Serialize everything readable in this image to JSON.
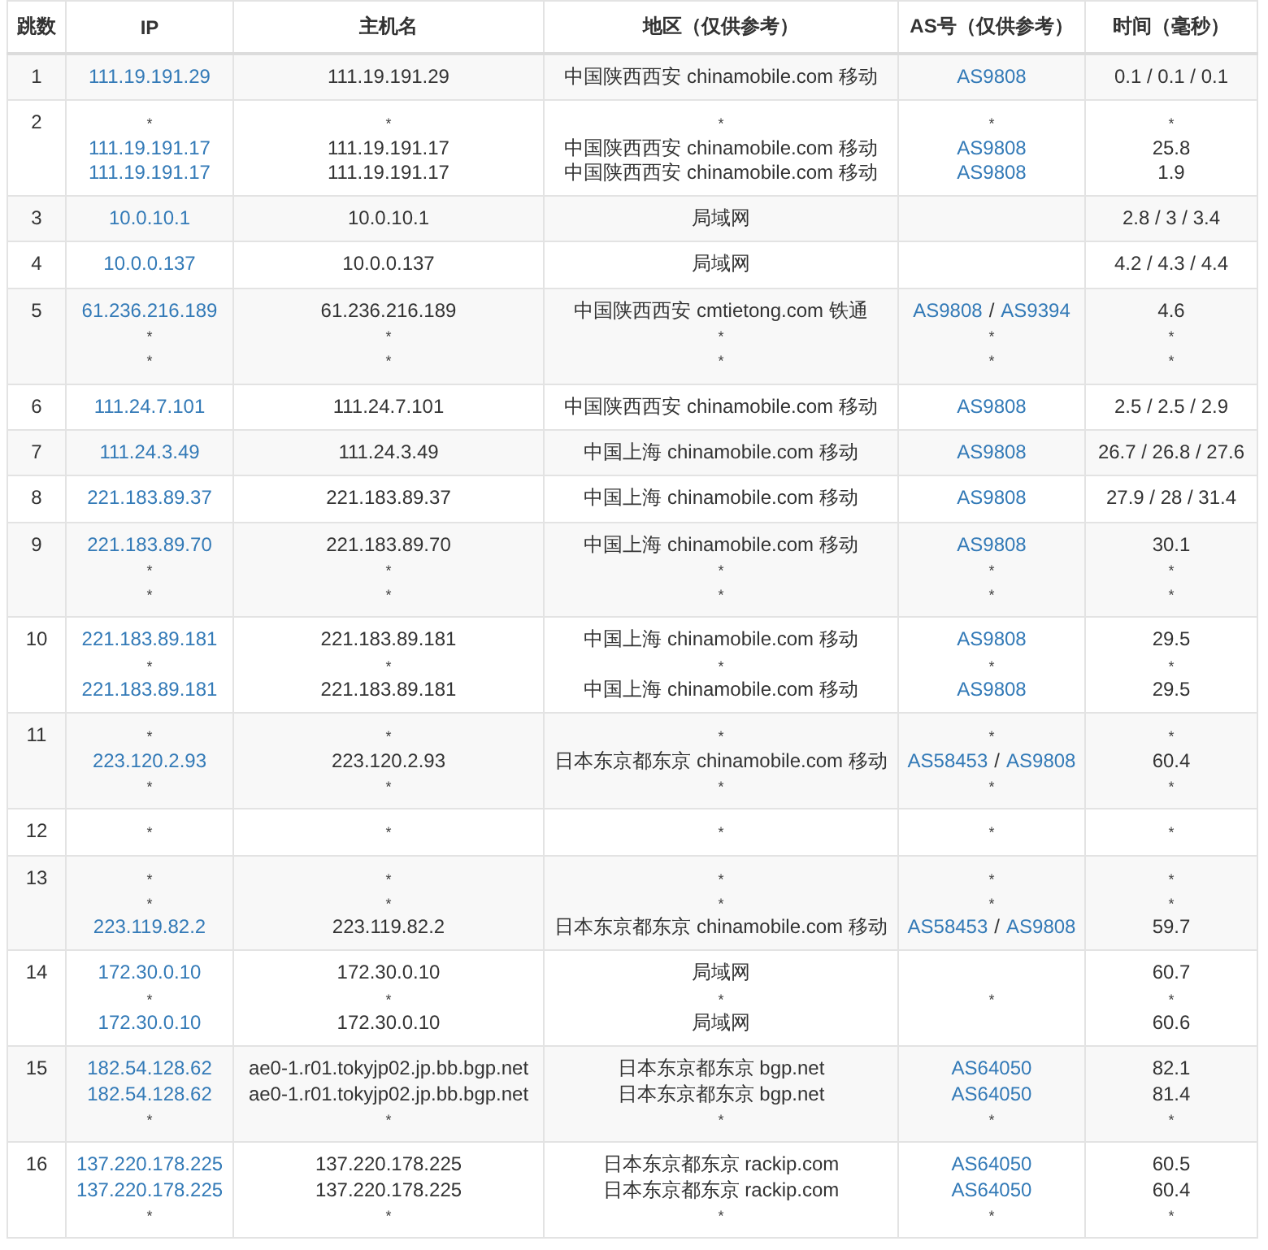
{
  "columns": [
    "跳数",
    "IP",
    "主机名",
    "地区（仅供参考）",
    "AS号（仅供参考）",
    "时间（毫秒）"
  ],
  "hops": [
    {
      "hop": "1",
      "ip": [
        {
          "kind": "link",
          "text": "111.19.191.29"
        }
      ],
      "host": [
        {
          "kind": "text",
          "text": "111.19.191.29"
        }
      ],
      "region": [
        {
          "kind": "text",
          "text": "中国陕西西安 chinamobile.com 移动"
        }
      ],
      "asn": [
        {
          "kind": "as",
          "parts": [
            "AS9808"
          ]
        }
      ],
      "time": [
        {
          "kind": "text",
          "text": "0.1 / 0.1 / 0.1"
        }
      ]
    },
    {
      "hop": "2",
      "ip": [
        {
          "kind": "star",
          "text": "*"
        },
        {
          "kind": "link",
          "text": "111.19.191.17"
        },
        {
          "kind": "link",
          "text": "111.19.191.17"
        }
      ],
      "host": [
        {
          "kind": "star",
          "text": "*"
        },
        {
          "kind": "text",
          "text": "111.19.191.17"
        },
        {
          "kind": "text",
          "text": "111.19.191.17"
        }
      ],
      "region": [
        {
          "kind": "star",
          "text": "*"
        },
        {
          "kind": "text",
          "text": "中国陕西西安 chinamobile.com 移动"
        },
        {
          "kind": "text",
          "text": "中国陕西西安 chinamobile.com 移动"
        }
      ],
      "asn": [
        {
          "kind": "star",
          "text": "*"
        },
        {
          "kind": "as",
          "parts": [
            "AS9808"
          ]
        },
        {
          "kind": "as",
          "parts": [
            "AS9808"
          ]
        }
      ],
      "time": [
        {
          "kind": "star",
          "text": "*"
        },
        {
          "kind": "text",
          "text": "25.8"
        },
        {
          "kind": "text",
          "text": "1.9"
        }
      ]
    },
    {
      "hop": "3",
      "ip": [
        {
          "kind": "link",
          "text": "10.0.10.1"
        }
      ],
      "host": [
        {
          "kind": "text",
          "text": "10.0.10.1"
        }
      ],
      "region": [
        {
          "kind": "text",
          "text": "局域网"
        }
      ],
      "time": [
        {
          "kind": "text",
          "text": "2.8 / 3 / 3.4"
        }
      ]
    },
    {
      "hop": "4",
      "ip": [
        {
          "kind": "link",
          "text": "10.0.0.137"
        }
      ],
      "host": [
        {
          "kind": "text",
          "text": "10.0.0.137"
        }
      ],
      "region": [
        {
          "kind": "text",
          "text": "局域网"
        }
      ],
      "time": [
        {
          "kind": "text",
          "text": "4.2 / 4.3 / 4.4"
        }
      ]
    },
    {
      "hop": "5",
      "ip": [
        {
          "kind": "link",
          "text": "61.236.216.189"
        },
        {
          "kind": "star",
          "text": "*"
        },
        {
          "kind": "star",
          "text": "*"
        }
      ],
      "host": [
        {
          "kind": "text",
          "text": "61.236.216.189"
        },
        {
          "kind": "star",
          "text": "*"
        },
        {
          "kind": "star",
          "text": "*"
        }
      ],
      "region": [
        {
          "kind": "text",
          "text": "中国陕西西安 cmtietong.com 铁通"
        },
        {
          "kind": "star",
          "text": "*"
        },
        {
          "kind": "star",
          "text": "*"
        }
      ],
      "asn": [
        {
          "kind": "as",
          "parts": [
            "AS9808",
            "/",
            "AS9394"
          ]
        },
        {
          "kind": "star",
          "text": "*"
        },
        {
          "kind": "star",
          "text": "*"
        }
      ],
      "time": [
        {
          "kind": "text",
          "text": "4.6"
        },
        {
          "kind": "star",
          "text": "*"
        },
        {
          "kind": "star",
          "text": "*"
        }
      ]
    },
    {
      "hop": "6",
      "ip": [
        {
          "kind": "link",
          "text": "111.24.7.101"
        }
      ],
      "host": [
        {
          "kind": "text",
          "text": "111.24.7.101"
        }
      ],
      "region": [
        {
          "kind": "text",
          "text": "中国陕西西安 chinamobile.com 移动"
        }
      ],
      "asn": [
        {
          "kind": "as",
          "parts": [
            "AS9808"
          ]
        }
      ],
      "time": [
        {
          "kind": "text",
          "text": "2.5 / 2.5 / 2.9"
        }
      ]
    },
    {
      "hop": "7",
      "ip": [
        {
          "kind": "link",
          "text": "111.24.3.49"
        }
      ],
      "host": [
        {
          "kind": "text",
          "text": "111.24.3.49"
        }
      ],
      "region": [
        {
          "kind": "text",
          "text": "中国上海 chinamobile.com 移动"
        }
      ],
      "asn": [
        {
          "kind": "as",
          "parts": [
            "AS9808"
          ]
        }
      ],
      "time": [
        {
          "kind": "text",
          "text": "26.7 / 26.8 / 27.6"
        }
      ]
    },
    {
      "hop": "8",
      "ip": [
        {
          "kind": "link",
          "text": "221.183.89.37"
        }
      ],
      "host": [
        {
          "kind": "text",
          "text": "221.183.89.37"
        }
      ],
      "region": [
        {
          "kind": "text",
          "text": "中国上海 chinamobile.com 移动"
        }
      ],
      "asn": [
        {
          "kind": "as",
          "parts": [
            "AS9808"
          ]
        }
      ],
      "time": [
        {
          "kind": "text",
          "text": "27.9 / 28 / 31.4"
        }
      ]
    },
    {
      "hop": "9",
      "ip": [
        {
          "kind": "link",
          "text": "221.183.89.70"
        },
        {
          "kind": "star",
          "text": "*"
        },
        {
          "kind": "star",
          "text": "*"
        }
      ],
      "host": [
        {
          "kind": "text",
          "text": "221.183.89.70"
        },
        {
          "kind": "star",
          "text": "*"
        },
        {
          "kind": "star",
          "text": "*"
        }
      ],
      "region": [
        {
          "kind": "text",
          "text": "中国上海 chinamobile.com 移动"
        },
        {
          "kind": "star",
          "text": "*"
        },
        {
          "kind": "star",
          "text": "*"
        }
      ],
      "asn": [
        {
          "kind": "as",
          "parts": [
            "AS9808"
          ]
        },
        {
          "kind": "star",
          "text": "*"
        },
        {
          "kind": "star",
          "text": "*"
        }
      ],
      "time": [
        {
          "kind": "text",
          "text": "30.1"
        },
        {
          "kind": "star",
          "text": "*"
        },
        {
          "kind": "star",
          "text": "*"
        }
      ]
    },
    {
      "hop": "10",
      "ip": [
        {
          "kind": "link",
          "text": "221.183.89.181"
        },
        {
          "kind": "star",
          "text": "*"
        },
        {
          "kind": "link",
          "text": "221.183.89.181"
        }
      ],
      "host": [
        {
          "kind": "text",
          "text": "221.183.89.181"
        },
        {
          "kind": "star",
          "text": "*"
        },
        {
          "kind": "text",
          "text": "221.183.89.181"
        }
      ],
      "region": [
        {
          "kind": "text",
          "text": "中国上海 chinamobile.com 移动"
        },
        {
          "kind": "star",
          "text": "*"
        },
        {
          "kind": "text",
          "text": "中国上海 chinamobile.com 移动"
        }
      ],
      "asn": [
        {
          "kind": "as",
          "parts": [
            "AS9808"
          ]
        },
        {
          "kind": "star",
          "text": "*"
        },
        {
          "kind": "as",
          "parts": [
            "AS9808"
          ]
        }
      ],
      "time": [
        {
          "kind": "text",
          "text": "29.5"
        },
        {
          "kind": "star",
          "text": "*"
        },
        {
          "kind": "text",
          "text": "29.5"
        }
      ]
    },
    {
      "hop": "11",
      "ip": [
        {
          "kind": "star",
          "text": "*"
        },
        {
          "kind": "link",
          "text": "223.120.2.93"
        },
        {
          "kind": "star",
          "text": "*"
        }
      ],
      "host": [
        {
          "kind": "star",
          "text": "*"
        },
        {
          "kind": "text",
          "text": "223.120.2.93"
        },
        {
          "kind": "star",
          "text": "*"
        }
      ],
      "region": [
        {
          "kind": "star",
          "text": "*"
        },
        {
          "kind": "text",
          "text": "日本东京都东京 chinamobile.com 移动"
        },
        {
          "kind": "star",
          "text": "*"
        }
      ],
      "asn": [
        {
          "kind": "star",
          "text": "*"
        },
        {
          "kind": "as",
          "parts": [
            "AS58453",
            "/",
            "AS9808"
          ]
        },
        {
          "kind": "star",
          "text": "*"
        }
      ],
      "time": [
        {
          "kind": "star",
          "text": "*"
        },
        {
          "kind": "text",
          "text": "60.4"
        },
        {
          "kind": "star",
          "text": "*"
        }
      ]
    },
    {
      "hop": "12",
      "ip": [
        {
          "kind": "star",
          "text": "*"
        }
      ],
      "host": [
        {
          "kind": "star",
          "text": "*"
        }
      ],
      "region": [
        {
          "kind": "star",
          "text": "*"
        }
      ],
      "asn": [
        {
          "kind": "star",
          "text": "*"
        }
      ],
      "time": [
        {
          "kind": "star",
          "text": "*"
        }
      ]
    },
    {
      "hop": "13",
      "ip": [
        {
          "kind": "star",
          "text": "*"
        },
        {
          "kind": "star",
          "text": "*"
        },
        {
          "kind": "link",
          "text": "223.119.82.2"
        }
      ],
      "host": [
        {
          "kind": "star",
          "text": "*"
        },
        {
          "kind": "star",
          "text": "*"
        },
        {
          "kind": "text",
          "text": "223.119.82.2"
        }
      ],
      "region": [
        {
          "kind": "star",
          "text": "*"
        },
        {
          "kind": "star",
          "text": "*"
        },
        {
          "kind": "text",
          "text": "日本东京都东京 chinamobile.com 移动"
        }
      ],
      "asn": [
        {
          "kind": "star",
          "text": "*"
        },
        {
          "kind": "star",
          "text": "*"
        },
        {
          "kind": "as",
          "parts": [
            "AS58453",
            "/",
            "AS9808"
          ]
        }
      ],
      "time": [
        {
          "kind": "star",
          "text": "*"
        },
        {
          "kind": "star",
          "text": "*"
        },
        {
          "kind": "text",
          "text": "59.7"
        }
      ]
    },
    {
      "hop": "14",
      "ip": [
        {
          "kind": "link",
          "text": "172.30.0.10"
        },
        {
          "kind": "star",
          "text": "*"
        },
        {
          "kind": "link",
          "text": "172.30.0.10"
        }
      ],
      "host": [
        {
          "kind": "text",
          "text": "172.30.0.10"
        },
        {
          "kind": "star",
          "text": "*"
        },
        {
          "kind": "text",
          "text": "172.30.0.10"
        }
      ],
      "region": [
        {
          "kind": "text",
          "text": "局域网"
        },
        {
          "kind": "star",
          "text": "*"
        },
        {
          "kind": "text",
          "text": "局域网"
        }
      ],
      "asn": [
        {
          "kind": "star",
          "text": "*"
        }
      ],
      "time": [
        {
          "kind": "text",
          "text": "60.7"
        },
        {
          "kind": "star",
          "text": "*"
        },
        {
          "kind": "text",
          "text": "60.6"
        }
      ]
    },
    {
      "hop": "15",
      "ip": [
        {
          "kind": "link",
          "text": "182.54.128.62"
        },
        {
          "kind": "link",
          "text": "182.54.128.62"
        },
        {
          "kind": "star",
          "text": "*"
        }
      ],
      "host": [
        {
          "kind": "text",
          "text": "ae0-1.r01.tokyjp02.jp.bb.bgp.net"
        },
        {
          "kind": "text",
          "text": "ae0-1.r01.tokyjp02.jp.bb.bgp.net"
        },
        {
          "kind": "star",
          "text": "*"
        }
      ],
      "region": [
        {
          "kind": "text",
          "text": "日本东京都东京 bgp.net"
        },
        {
          "kind": "text",
          "text": "日本东京都东京 bgp.net"
        },
        {
          "kind": "star",
          "text": "*"
        }
      ],
      "asn": [
        {
          "kind": "as",
          "parts": [
            "AS64050"
          ]
        },
        {
          "kind": "as",
          "parts": [
            "AS64050"
          ]
        },
        {
          "kind": "star",
          "text": "*"
        }
      ],
      "time": [
        {
          "kind": "text",
          "text": "82.1"
        },
        {
          "kind": "text",
          "text": "81.4"
        },
        {
          "kind": "star",
          "text": "*"
        }
      ]
    },
    {
      "hop": "16",
      "ip": [
        {
          "kind": "link",
          "text": "137.220.178.225"
        },
        {
          "kind": "link",
          "text": "137.220.178.225"
        },
        {
          "kind": "star",
          "text": "*"
        }
      ],
      "host": [
        {
          "kind": "text",
          "text": "137.220.178.225"
        },
        {
          "kind": "text",
          "text": "137.220.178.225"
        },
        {
          "kind": "star",
          "text": "*"
        }
      ],
      "region": [
        {
          "kind": "text",
          "text": "日本东京都东京 rackip.com"
        },
        {
          "kind": "text",
          "text": "日本东京都东京 rackip.com"
        },
        {
          "kind": "star",
          "text": "*"
        }
      ],
      "asn": [
        {
          "kind": "as",
          "parts": [
            "AS64050"
          ]
        },
        {
          "kind": "as",
          "parts": [
            "AS64050"
          ]
        },
        {
          "kind": "star",
          "text": "*"
        }
      ],
      "time": [
        {
          "kind": "text",
          "text": "60.5"
        },
        {
          "kind": "text",
          "text": "60.4"
        },
        {
          "kind": "star",
          "text": "*"
        }
      ]
    }
  ]
}
